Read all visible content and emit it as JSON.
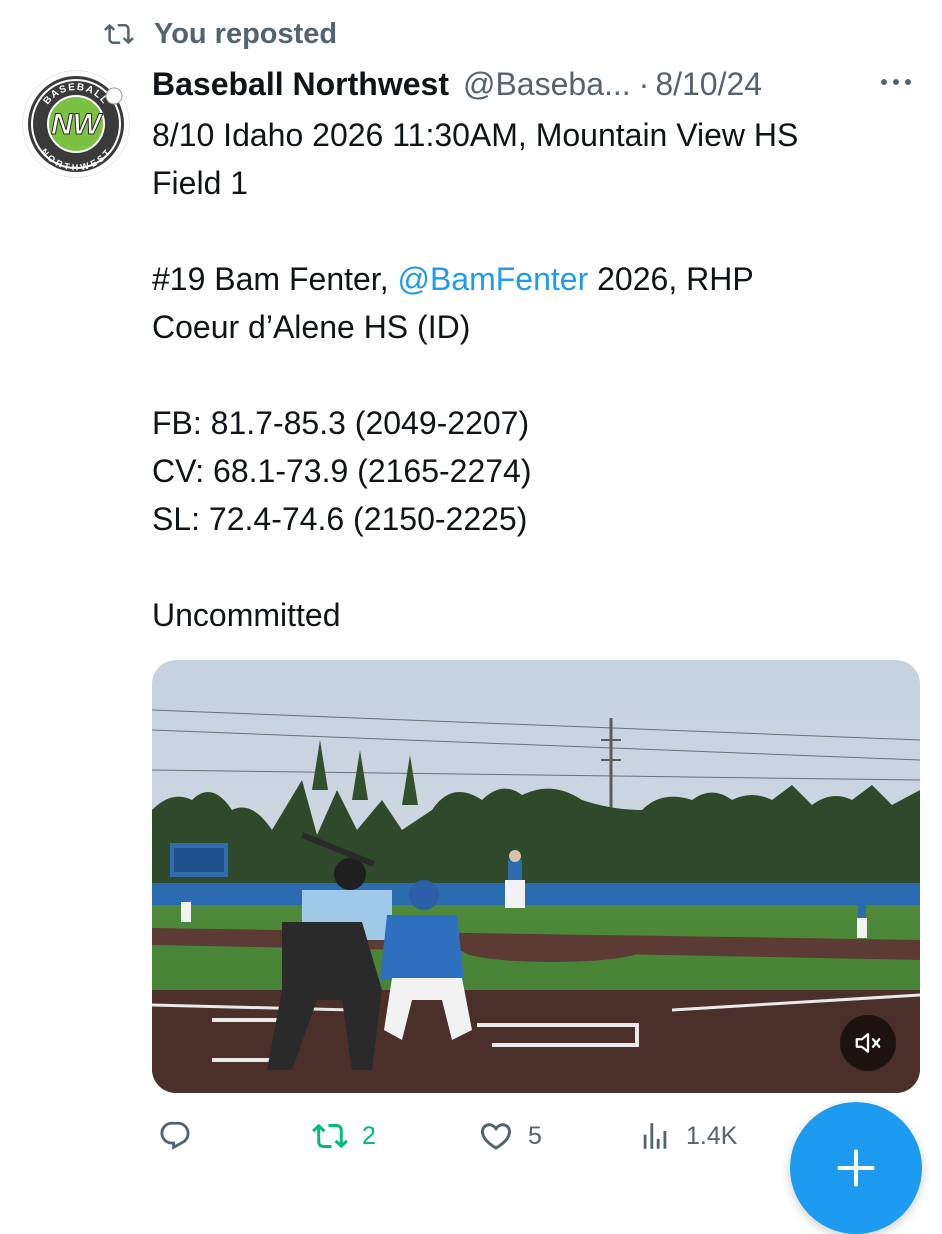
{
  "repost_header": {
    "icon": "repost-icon",
    "label": "You reposted"
  },
  "tweet": {
    "author_name": "Baseball Northwest",
    "author_handle": "@Baseba...",
    "separator": "·",
    "date": "8/10/24",
    "more_icon": "more-icon",
    "avatar_logo": {
      "top_text": "BASEBALL",
      "bottom_text": "NORTHWEST",
      "mark": "NW"
    },
    "text": {
      "line1": "8/10 Idaho 2026 11:30AM, Mountain View HS",
      "line2": "Field 1",
      "player_prefix": "#19 Bam Fenter, ",
      "player_mention": "@BamFenter",
      "player_suffix": " 2026, RHP",
      "school": "Coeur d’Alene HS (ID)",
      "fb": "FB: 81.7-85.3 (2049-2207)",
      "cv": "CV: 68.1-73.9 (2165-2274)",
      "sl": "SL: 72.4-74.6 (2150-2225)",
      "status": "Uncommitted"
    }
  },
  "media": {
    "type": "video",
    "mute_icon": "speaker-muted-icon"
  },
  "actions": {
    "reply": {
      "icon": "reply-icon",
      "count": ""
    },
    "repost": {
      "icon": "repost-icon",
      "count": "2",
      "active": true
    },
    "like": {
      "icon": "heart-icon",
      "count": "5"
    },
    "views": {
      "icon": "views-bar-chart-icon",
      "count": "1.4K"
    }
  },
  "fab": {
    "icon": "plus-icon"
  },
  "colors": {
    "text_primary": "#0f1419",
    "text_secondary": "#536471",
    "accent_blue": "#1d9bf0",
    "repost_green": "#00ba7c"
  }
}
